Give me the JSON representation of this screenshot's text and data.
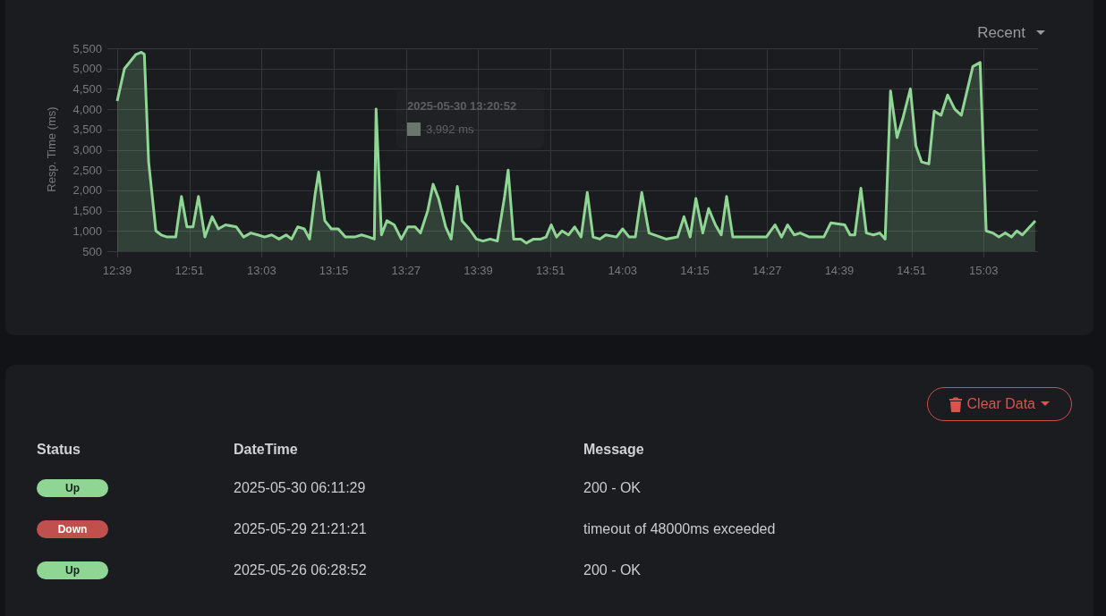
{
  "chart_panel": {
    "range_dropdown": {
      "label": "Recent"
    },
    "tooltip": {
      "title": "2025-05-30 13:20:52",
      "value": "3,992 ms",
      "color": "#6b776c"
    },
    "chart_data": {
      "type": "area",
      "ylabel": "Resp. Time (ms)",
      "grid": true,
      "x": [
        12.65,
        12.67,
        12.702,
        12.717,
        12.725,
        12.737,
        12.757,
        12.772,
        12.788,
        12.812,
        12.828,
        12.843,
        12.86,
        12.875,
        12.893,
        12.913,
        12.93,
        12.95,
        12.98,
        13.0,
        13.02,
        13.04,
        13.058,
        13.078,
        13.098,
        13.118,
        13.133,
        13.15,
        13.168,
        13.183,
        13.198,
        13.208,
        13.225,
        13.243,
        13.262,
        13.282,
        13.307,
        13.327,
        13.347,
        13.362,
        13.367,
        13.382,
        13.397,
        13.417,
        13.437,
        13.455,
        13.475,
        13.49,
        13.51,
        13.525,
        13.54,
        13.56,
        13.575,
        13.592,
        13.605,
        13.625,
        13.645,
        13.663,
        13.683,
        13.703,
        13.723,
        13.733,
        13.748,
        13.768,
        13.783,
        13.803,
        13.823,
        13.838,
        13.852,
        13.867,
        13.882,
        13.9,
        13.917,
        13.935,
        13.952,
        13.968,
        13.987,
        14.003,
        14.033,
        14.05,
        14.068,
        14.085,
        14.103,
        14.123,
        14.17,
        14.202,
        14.22,
        14.237,
        14.253,
        14.272,
        14.288,
        14.307,
        14.323,
        14.338,
        14.355,
        14.378,
        14.408,
        14.448,
        14.472,
        14.49,
        14.507,
        14.525,
        14.542,
        14.567,
        14.607,
        14.627,
        14.665,
        14.68,
        14.693,
        14.71,
        14.725,
        14.745,
        14.762,
        14.777,
        14.792,
        14.81,
        14.827,
        14.847,
        14.862,
        14.878,
        14.898,
        14.913,
        14.932,
        14.95,
        14.97,
        14.988,
        15.02,
        15.04,
        15.057,
        15.075,
        15.092,
        15.11,
        15.127,
        15.142,
        15.157,
        15.193
      ],
      "series": [
        {
          "color": "#8fd694",
          "values": [
            4200,
            5000,
            5350,
            5400,
            5350,
            2700,
            1000,
            900,
            850,
            850,
            1850,
            1100,
            1100,
            1850,
            850,
            1350,
            1050,
            1150,
            1100,
            850,
            950,
            900,
            850,
            900,
            800,
            900,
            800,
            1100,
            1050,
            800,
            1900,
            2450,
            1250,
            1050,
            1050,
            850,
            850,
            900,
            850,
            800,
            4000,
            900,
            1250,
            1150,
            800,
            1100,
            1100,
            950,
            1500,
            2150,
            1800,
            1100,
            800,
            2100,
            1250,
            1050,
            800,
            750,
            800,
            750,
            1850,
            2500,
            800,
            800,
            700,
            800,
            800,
            850,
            1150,
            850,
            1000,
            900,
            1100,
            850,
            1950,
            850,
            800,
            900,
            850,
            1050,
            850,
            850,
            1950,
            950,
            800,
            850,
            1350,
            850,
            1800,
            950,
            1550,
            1150,
            900,
            1850,
            850,
            850,
            850,
            850,
            1150,
            850,
            1150,
            900,
            950,
            850,
            850,
            1200,
            1150,
            900,
            900,
            2050,
            950,
            900,
            950,
            800,
            4450,
            3300,
            3800,
            4500,
            3100,
            2700,
            2650,
            3950,
            3850,
            4350,
            4000,
            3850,
            5050,
            5150,
            1000,
            950,
            850,
            950,
            850,
            1000,
            900,
            1250
          ]
        }
      ],
      "xlim": [
        12.65,
        15.193
      ],
      "ylim": [
        500,
        5500
      ],
      "xticks": [
        {
          "value": 12.65,
          "label": "12:39"
        },
        {
          "value": 12.85,
          "label": "12:51"
        },
        {
          "value": 13.05,
          "label": "13:03"
        },
        {
          "value": 13.25,
          "label": "13:15"
        },
        {
          "value": 13.45,
          "label": "13:27"
        },
        {
          "value": 13.65,
          "label": "13:39"
        },
        {
          "value": 13.85,
          "label": "13:51"
        },
        {
          "value": 14.05,
          "label": "14:03"
        },
        {
          "value": 14.25,
          "label": "14:15"
        },
        {
          "value": 14.45,
          "label": "14:27"
        },
        {
          "value": 14.65,
          "label": "14:39"
        },
        {
          "value": 14.85,
          "label": "14:51"
        },
        {
          "value": 15.05,
          "label": "15:03"
        }
      ],
      "yticks": [
        {
          "value": 500,
          "label": "500"
        },
        {
          "value": 1000,
          "label": "1,000"
        },
        {
          "value": 1500,
          "label": "1,500"
        },
        {
          "value": 2000,
          "label": "2,000"
        },
        {
          "value": 2500,
          "label": "2,500"
        },
        {
          "value": 3000,
          "label": "3,000"
        },
        {
          "value": 3500,
          "label": "3,500"
        },
        {
          "value": 4000,
          "label": "4,000"
        },
        {
          "value": 4500,
          "label": "4,500"
        },
        {
          "value": 5000,
          "label": "5,000"
        },
        {
          "value": 5500,
          "label": "5,500"
        }
      ]
    }
  },
  "events_panel": {
    "clear_button": {
      "label": "Clear Data"
    },
    "columns": [
      "Status",
      "DateTime",
      "Message"
    ],
    "rows": [
      {
        "status": {
          "label": "Up",
          "kind": "up"
        },
        "datetime": "2025-05-30 06:11:29",
        "message": "200 - OK"
      },
      {
        "status": {
          "label": "Down",
          "kind": "down"
        },
        "datetime": "2025-05-29 21:21:21",
        "message": "timeout of 48000ms exceeded"
      },
      {
        "status": {
          "label": "Up",
          "kind": "up"
        },
        "datetime": "2025-05-26 06:28:52",
        "message": "200 - OK"
      }
    ]
  }
}
